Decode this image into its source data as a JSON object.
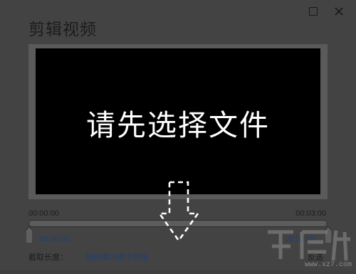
{
  "window": {
    "title": "剪辑视频",
    "maximize_icon": "maximize-icon",
    "close_icon": "close-icon"
  },
  "player": {
    "message": "请先选择文件"
  },
  "timeline": {
    "start_time": "00:00:00",
    "end_time": "00:03:00",
    "selection_start": "00:00:00",
    "selection_end": "00:03:00",
    "handle_icon": "slider-handle-icon"
  },
  "footer": {
    "length_label": "截取长度：",
    "hint": "拖动滑块选中范围",
    "invert_label": "反选"
  },
  "overlay": {
    "arrow_icon": "dashed-down-arrow-icon",
    "watermark_text": "www.xz7.com"
  },
  "colors": {
    "background": "#434343",
    "screen": "#000000",
    "link": "#223f70",
    "text": "#1d1d1d"
  }
}
